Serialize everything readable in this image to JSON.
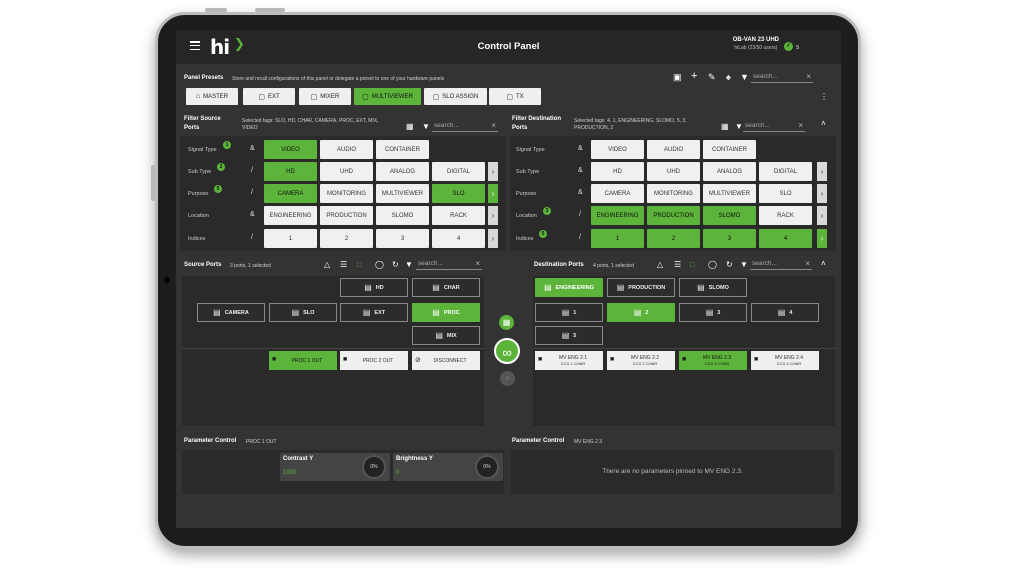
{
  "header": {
    "title": "Control Panel",
    "device_name": "OB-VAN 23 UHD",
    "device_users": "hiLab (23/50 users)",
    "status_count": "5"
  },
  "panel_presets": {
    "title": "Panel Presets",
    "subtitle": "Store and recall configurations of this panel or delegate a preset to one of your hardware panels",
    "search_placeholder": "search...",
    "items": [
      {
        "label": "MASTER",
        "icon": "home-icon"
      },
      {
        "label": "EXT",
        "icon": "monitor-icon"
      },
      {
        "label": "MIXER",
        "icon": "monitor-icon"
      },
      {
        "label": "MULTIVIEWER",
        "icon": "monitor-icon",
        "selected": true
      },
      {
        "label": "SLO ASSIGN",
        "icon": "monitor-icon"
      },
      {
        "label": "TX",
        "icon": "monitor-icon"
      }
    ]
  },
  "filter_source": {
    "title": "Filter Source Ports",
    "tags": "Selected tags: SLO, HD, CHAR, CAMERA, PROC, EXT, MIX, VIDEO",
    "search_placeholder": "search...",
    "rows": [
      {
        "label": "Signal Type",
        "badge": "1",
        "op": "&",
        "options": [
          "VIDEO",
          "AUDIO",
          "CONTAINER"
        ]
      },
      {
        "label": "Sub Type",
        "badge": "2",
        "op": "/",
        "options": [
          "HD",
          "UHD",
          "ANALOG",
          "DIGITAL"
        ]
      },
      {
        "label": "Purpose",
        "badge": "5",
        "op": "/",
        "options": [
          "CAMERA",
          "MONITORING",
          "MULTIVIEWER",
          "SLO"
        ]
      },
      {
        "label": "Location",
        "badge": "",
        "op": "&",
        "options": [
          "ENGINEERING",
          "PRODUCTION",
          "SLOMO",
          "RACK"
        ]
      },
      {
        "label": "Indices",
        "badge": "",
        "op": "/",
        "options": [
          "1",
          "2",
          "3",
          "4"
        ]
      }
    ]
  },
  "filter_dest": {
    "title": "Filter Destination Ports",
    "tags": "Selected tags: 4, 1, ENGINEERING, SLOMO, 5, 3, PRODUCTION, 2",
    "search_placeholder": "search...",
    "rows": [
      {
        "label": "Signal Type",
        "badge": "",
        "op": "&",
        "options": [
          "VIDEO",
          "AUDIO",
          "CONTAINER"
        ]
      },
      {
        "label": "Sub Type",
        "badge": "",
        "op": "&",
        "options": [
          "HD",
          "UHD",
          "ANALOG",
          "DIGITAL"
        ]
      },
      {
        "label": "Purpose",
        "badge": "",
        "op": "&",
        "options": [
          "CAMERA",
          "MONITORING",
          "MULTIVIEWER",
          "SLO"
        ]
      },
      {
        "label": "Location",
        "badge": "3",
        "op": "/",
        "options": [
          "ENGINEERING",
          "PRODUCTION",
          "SLOMO",
          "RACK"
        ]
      },
      {
        "label": "Indices",
        "badge": "5",
        "op": "/",
        "options": [
          "1",
          "2",
          "3",
          "4"
        ]
      }
    ]
  },
  "source_ports": {
    "title": "Source Ports",
    "count": "3 ports, 1 selected",
    "search_placeholder": "search...",
    "folders_row1": [
      "HD",
      "CHAR"
    ],
    "folders_row2": [
      "CAMERA",
      "SLO",
      "EXT",
      "PROC"
    ],
    "folders_row3": [
      "MIX"
    ],
    "ports": [
      "PROC 1 OUT",
      "PROC 2 OUT",
      "DISCONNECT"
    ]
  },
  "dest_ports": {
    "title": "Destination Ports",
    "count": "4 ports, 1 selected",
    "search_placeholder": "search...",
    "folders_row1": [
      "ENGINEERING",
      "PRODUCTION",
      "SLOMO"
    ],
    "folders_row2": [
      "1",
      "2",
      "3",
      "4"
    ],
    "folders_row3": [
      "5"
    ],
    "ports": [
      {
        "name": "MV ENG 2.1",
        "sub": "CCU 1 CHAR"
      },
      {
        "name": "MV ENG 2.2",
        "sub": "CCU 2 CHAR"
      },
      {
        "name": "MV ENG 2.3",
        "sub": "CCU 3 CHAR"
      },
      {
        "name": "MV ENG 2.4",
        "sub": "CCU 4 CHAR"
      }
    ]
  },
  "param_left": {
    "title": "Parameter Control",
    "target": "PROC 1 OUT",
    "params": [
      {
        "name": "Contrast Y",
        "value": "1000",
        "knob": "0%"
      },
      {
        "name": "Brightness Y",
        "value": "0",
        "knob": "0%"
      }
    ]
  },
  "param_right": {
    "title": "Parameter Control",
    "target": "MV ENG 2.3",
    "empty": "There are no parameters pinned to MV ENG 2.3."
  },
  "colors": {
    "accent": "#5db43a",
    "background": "#333333",
    "panel": "#2a2a2a"
  }
}
